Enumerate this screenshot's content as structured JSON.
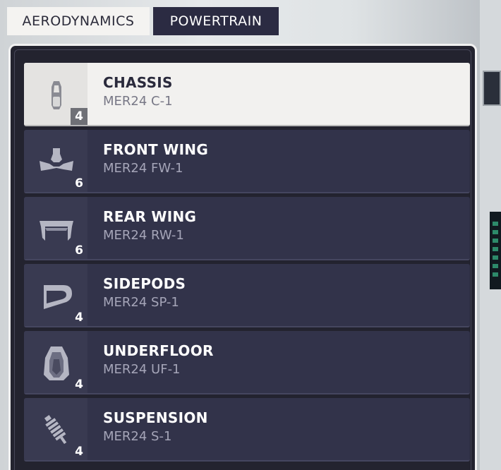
{
  "tabs": [
    {
      "label": "AERODYNAMICS",
      "active": true
    },
    {
      "label": "POWERTRAIN",
      "active": false
    }
  ],
  "parts": [
    {
      "name": "CHASSIS",
      "code": "MER24 C-1",
      "count": "4",
      "icon": "chassis-icon",
      "selected": true
    },
    {
      "name": "FRONT WING",
      "code": "MER24 FW-1",
      "count": "6",
      "icon": "front-wing-icon",
      "selected": false
    },
    {
      "name": "REAR WING",
      "code": "MER24 RW-1",
      "count": "6",
      "icon": "rear-wing-icon",
      "selected": false
    },
    {
      "name": "SIDEPODS",
      "code": "MER24 SP-1",
      "count": "4",
      "icon": "sidepods-icon",
      "selected": false
    },
    {
      "name": "UNDERFLOOR",
      "code": "MER24 UF-1",
      "count": "4",
      "icon": "underfloor-icon",
      "selected": false
    },
    {
      "name": "SUSPENSION",
      "code": "MER24 S-1",
      "count": "4",
      "icon": "suspension-icon",
      "selected": false
    }
  ],
  "colors": {
    "panel": "#23232f",
    "row": "#32334a",
    "selected_row": "#f2f1ef",
    "tab_active": "#f4f3f1",
    "tab_inactive": "#2b2b42"
  }
}
